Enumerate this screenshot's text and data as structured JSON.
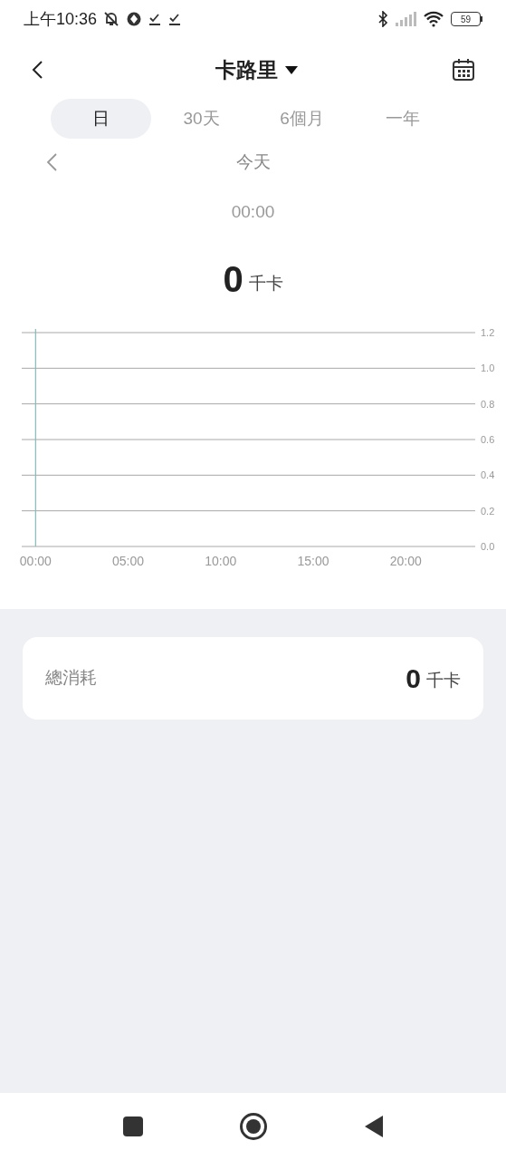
{
  "status_bar": {
    "time": "上午10:36",
    "battery": "59"
  },
  "header": {
    "title": "卡路里"
  },
  "tabs": [
    {
      "label": "日",
      "selected": true
    },
    {
      "label": "30天",
      "selected": false
    },
    {
      "label": "6個月",
      "selected": false
    },
    {
      "label": "一年",
      "selected": false
    }
  ],
  "date_nav": {
    "label": "今天"
  },
  "selection": {
    "time": "00:00",
    "value": "0",
    "unit": "千卡"
  },
  "chart_data": {
    "type": "bar",
    "xlim": [
      -0.75,
      23.75
    ],
    "ylim": [
      0,
      1.2
    ],
    "xticks": [
      {
        "value": 0,
        "label": "00:00"
      },
      {
        "value": 5,
        "label": "05:00"
      },
      {
        "value": 10,
        "label": "10:00"
      },
      {
        "value": 15,
        "label": "15:00"
      },
      {
        "value": 20,
        "label": "20:00"
      }
    ],
    "yticks": [
      {
        "value": 0,
        "label": "0.0"
      },
      {
        "value": 0.2,
        "label": "0.2"
      },
      {
        "value": 0.4,
        "label": "0.4"
      },
      {
        "value": 0.6,
        "label": "0.6"
      },
      {
        "value": 0.8,
        "label": "0.8"
      },
      {
        "value": 1,
        "label": "1.0"
      },
      {
        "value": 1.2,
        "label": "1.2"
      }
    ],
    "grid": true,
    "ref_lines": [
      {
        "axis": "x",
        "value": 0,
        "color": "#5ccfc4"
      }
    ]
  },
  "summary": {
    "label": "總消耗",
    "value": "0",
    "unit": "千卡"
  }
}
